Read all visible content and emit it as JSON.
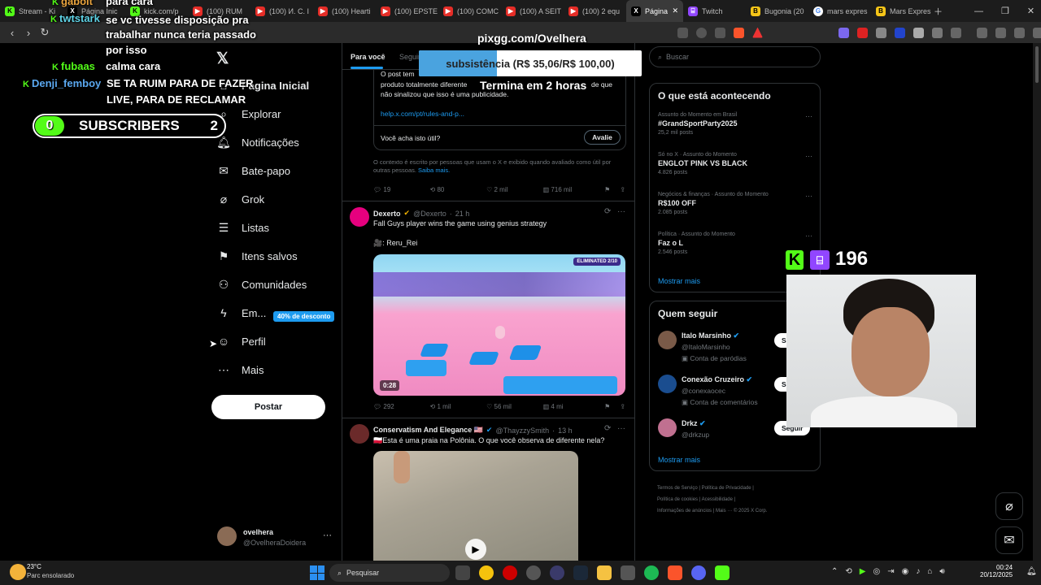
{
  "browser": {
    "tabs": [
      {
        "label": "Stream - Ki",
        "icon": "kick-icon"
      },
      {
        "label": "Página Inic",
        "icon": "x-icon"
      },
      {
        "label": "kick.com/p",
        "icon": "kick-icon"
      },
      {
        "label": "(100) RUM",
        "icon": "youtube-icon"
      },
      {
        "label": "(100) И. С. I",
        "icon": "youtube-icon"
      },
      {
        "label": "(100) Hearti",
        "icon": "youtube-icon"
      },
      {
        "label": "(100) EPSTE",
        "icon": "youtube-icon"
      },
      {
        "label": "(100) COMC",
        "icon": "youtube-icon"
      },
      {
        "label": "(100) A SEIT",
        "icon": "youtube-icon"
      },
      {
        "label": "(100) 2 equ",
        "icon": "youtube-icon"
      },
      {
        "label": "Página",
        "icon": "x-icon",
        "active": true
      },
      {
        "label": "Twitch",
        "icon": "twitch-icon"
      },
      {
        "label": "Bugonia (20",
        "icon": "imdb-icon"
      },
      {
        "label": "mars expres",
        "icon": "google-icon"
      },
      {
        "label": "Mars Expres",
        "icon": "imdb-icon"
      }
    ]
  },
  "x_nav": {
    "items": [
      {
        "label": "Página Inicial",
        "icon": "home-icon"
      },
      {
        "label": "Explorar",
        "icon": "search-icon"
      },
      {
        "label": "Notificações",
        "icon": "bell-icon"
      },
      {
        "label": "Bate-papo",
        "icon": "mail-icon"
      },
      {
        "label": "Grok",
        "icon": "grok-icon"
      },
      {
        "label": "Listas",
        "icon": "list-icon"
      },
      {
        "label": "Itens salvos",
        "icon": "bookmark-icon"
      },
      {
        "label": "Comunidades",
        "icon": "people-icon"
      },
      {
        "label": "Em...",
        "icon": "bolt-icon"
      },
      {
        "label": "Perfil",
        "icon": "person-icon"
      },
      {
        "label": "Mais",
        "icon": "more-icon"
      }
    ],
    "promo": "40% de desconto",
    "post_button": "Postar",
    "account": {
      "name": "ovelhera",
      "handle": "@OvelheraDoidera"
    }
  },
  "feed": {
    "tabs": [
      "Para você",
      "Seguir"
    ],
    "note": {
      "text": "O post tem ... produto totalmente diferente ... não sinalizou que isso é uma publicidade.",
      "line1": "O post tem",
      "line2": "produto totalmente diferente",
      "line2b": "de que",
      "line3": "não sinalizou que isso é uma publicidade.",
      "link": "help.x.com/pt/rules-and-p...",
      "question": "Você acha isto útil?",
      "rate_button": "Avalie",
      "footer": "O contexto é escrito por pessoas que usam o X e exibido quando avaliado como útil por outras pessoas.",
      "footer_link": "Saiba mais."
    },
    "post1_actions": {
      "replies": "19",
      "reposts": "80",
      "likes": "2 mil",
      "views": "716 mil"
    },
    "post2": {
      "author": "Dexerto",
      "handle": "@Dexerto",
      "time": "21 h",
      "text": "Fall Guys player wins the game using genius strategy",
      "credit": "🎥: Reru_Rei",
      "video_time": "0:28",
      "hud": "ELIMINATED 2/10",
      "actions": {
        "replies": "292",
        "reposts": "1 mil",
        "likes": "56 mil",
        "views": "4 mi"
      }
    },
    "post3": {
      "author": "Conservatism And Elegance 🇺🇸",
      "handle": "@ThayzzySmith",
      "time": "13 h",
      "text": "🇵🇱Esta é uma praia na Polônia. O que você observa de diferente nela?"
    }
  },
  "right": {
    "search_placeholder": "Buscar",
    "trends_title": "O que está acontecendo",
    "trends": [
      {
        "meta": "Assunto do Momento em Brasil",
        "name": "#GrandSportParty2025",
        "count": "25,2 mil posts"
      },
      {
        "meta": "Só no X · Assunto do Momento",
        "name": "ENGLOT PINK VS BLACK",
        "count": "4.826 posts"
      },
      {
        "meta": "Negócios & finanças · Assunto do Momento",
        "name": "R$100 OFF",
        "count": "2.085 posts"
      },
      {
        "meta": "Política · Assunto do Momento",
        "name": "Faz o L",
        "count": "2.546 posts"
      }
    ],
    "show_more": "Mostrar mais",
    "follow_title": "Quem seguir",
    "follow": [
      {
        "name": "Italo Marsinho",
        "handle": "@ItaloMarsinho",
        "sub": "Conta de paródias",
        "button": "S"
      },
      {
        "name": "Conexão Cruzeiro",
        "handle": "@conexaocec",
        "sub": "Conta de comentários",
        "button": "S"
      },
      {
        "name": "Drkz",
        "handle": "@drkzup",
        "sub": "",
        "button": "Seguir"
      }
    ],
    "show_more2": "Mostrar mais",
    "footer": [
      "Termos de Serviço",
      "Política de Privacidade",
      "Política de cookies",
      "Acessibilidade",
      "Informações de anúncios",
      "Mais ···",
      "© 2025 X Corp."
    ]
  },
  "overlay": {
    "chat": [
      {
        "user": "gabolt",
        "msg": "para cara"
      },
      {
        "user": "twtstark",
        "msg": "se vc tivesse disposição pra trabalhar nunca teria passado por isso"
      },
      {
        "user": "fubaas",
        "msg": "calma cara"
      },
      {
        "user": "Denji_femboy",
        "msg": "SE TA RUIM PARA DE FAZER LIVE, PARA DE RECLAMAR"
      }
    ],
    "chat_line2a": "trabalhar nunca teria passado",
    "chat_line2b": "por isso",
    "chat_line4a": "SE TA RUIM PARA DE FAZER",
    "chat_line4b": "LIVE, PARA DE RECLAMAR",
    "subs_left": "0",
    "subs_label": "SUBSCRIBERS",
    "subs_right": "2",
    "pix": "pixgg.com/Ovelhera",
    "goal": "subsistência (R$ 35,06/R$ 100,00)",
    "goal_progress": 0.35,
    "goal_time": "Termina em 2 horas",
    "viewers": "196"
  },
  "taskbar": {
    "weather_temp": "23°C",
    "weather_desc": "Parc ensolarado",
    "search": "Pesquisar",
    "time": "00:24",
    "date": "20/12/2025"
  }
}
